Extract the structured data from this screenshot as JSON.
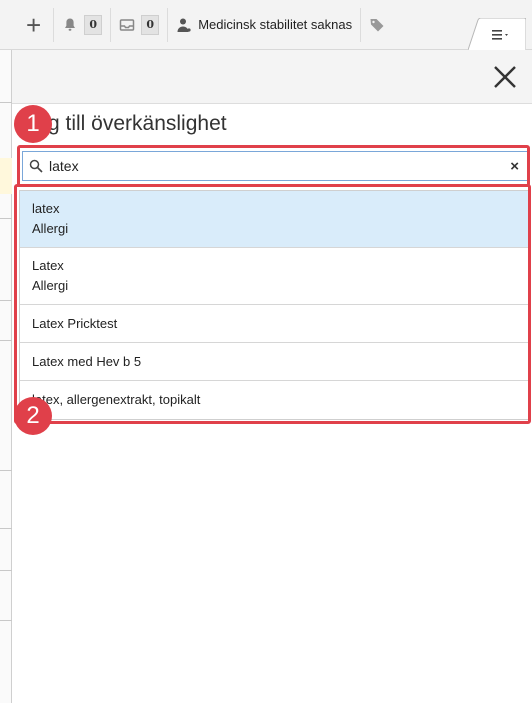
{
  "toolbar": {
    "add_label": "+",
    "notifications_count": "0",
    "messages_count": "0",
    "alert_label": "Medicinsk stabilitet saknas"
  },
  "panel": {
    "title": "Lägg till överkänslighet",
    "title_visible": "g till överkänslighet",
    "close_label": "✕"
  },
  "search": {
    "value": "latex",
    "clear_label": "×"
  },
  "results": [
    {
      "name": "latex",
      "category": "Allergi",
      "selected": true
    },
    {
      "name": "Latex",
      "category": "Allergi",
      "selected": false
    },
    {
      "name": "Latex Pricktest",
      "category": "",
      "selected": false
    },
    {
      "name": "Latex med Hev b 5",
      "category": "",
      "selected": false
    },
    {
      "name": "latex, allergenextrakt, topikalt",
      "category": "",
      "selected": false
    }
  ],
  "annotations": [
    {
      "number": "1"
    },
    {
      "number": "2"
    }
  ],
  "colors": {
    "annotation": "#e0404a",
    "selected_row": "#d9ecfa",
    "search_border": "#7aa7d9"
  }
}
